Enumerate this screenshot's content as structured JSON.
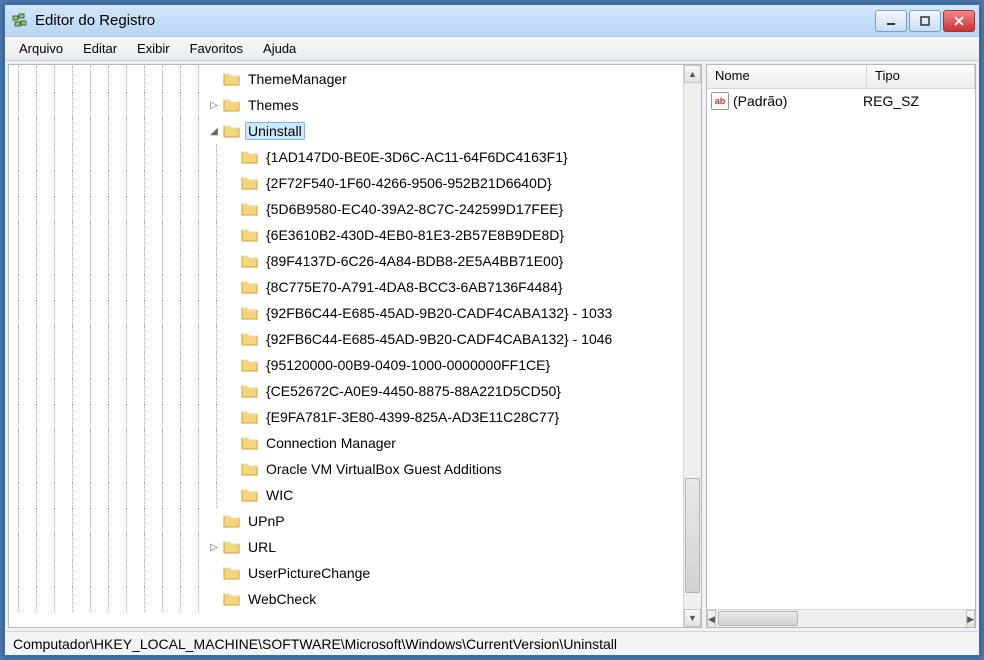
{
  "window": {
    "title": "Editor do Registro"
  },
  "menu": {
    "arquivo": "Arquivo",
    "editar": "Editar",
    "exibir": "Exibir",
    "favoritos": "Favoritos",
    "ajuda": "Ajuda"
  },
  "tree": {
    "items": [
      {
        "depth": 11,
        "expander": "",
        "label": "ThemeManager",
        "selected": false
      },
      {
        "depth": 11,
        "expander": "▷",
        "label": "Themes",
        "selected": false
      },
      {
        "depth": 11,
        "expander": "◢",
        "label": "Uninstall",
        "selected": true
      },
      {
        "depth": 12,
        "expander": "",
        "label": "{1AD147D0-BE0E-3D6C-AC11-64F6DC4163F1}",
        "selected": false
      },
      {
        "depth": 12,
        "expander": "",
        "label": "{2F72F540-1F60-4266-9506-952B21D6640D}",
        "selected": false
      },
      {
        "depth": 12,
        "expander": "",
        "label": "{5D6B9580-EC40-39A2-8C7C-242599D17FEE}",
        "selected": false
      },
      {
        "depth": 12,
        "expander": "",
        "label": "{6E3610B2-430D-4EB0-81E3-2B57E8B9DE8D}",
        "selected": false
      },
      {
        "depth": 12,
        "expander": "",
        "label": "{89F4137D-6C26-4A84-BDB8-2E5A4BB71E00}",
        "selected": false
      },
      {
        "depth": 12,
        "expander": "",
        "label": "{8C775E70-A791-4DA8-BCC3-6AB7136F4484}",
        "selected": false
      },
      {
        "depth": 12,
        "expander": "",
        "label": "{92FB6C44-E685-45AD-9B20-CADF4CABA132} - 1033",
        "selected": false
      },
      {
        "depth": 12,
        "expander": "",
        "label": "{92FB6C44-E685-45AD-9B20-CADF4CABA132} - 1046",
        "selected": false
      },
      {
        "depth": 12,
        "expander": "",
        "label": "{95120000-00B9-0409-1000-0000000FF1CE}",
        "selected": false
      },
      {
        "depth": 12,
        "expander": "",
        "label": "{CE52672C-A0E9-4450-8875-88A221D5CD50}",
        "selected": false
      },
      {
        "depth": 12,
        "expander": "",
        "label": "{E9FA781F-3E80-4399-825A-AD3E11C28C77}",
        "selected": false
      },
      {
        "depth": 12,
        "expander": "",
        "label": "Connection Manager",
        "selected": false
      },
      {
        "depth": 12,
        "expander": "",
        "label": "Oracle VM VirtualBox Guest Additions",
        "selected": false
      },
      {
        "depth": 12,
        "expander": "",
        "label": "WIC",
        "selected": false
      },
      {
        "depth": 11,
        "expander": "",
        "label": "UPnP",
        "selected": false
      },
      {
        "depth": 11,
        "expander": "▷",
        "label": "URL",
        "selected": false
      },
      {
        "depth": 11,
        "expander": "",
        "label": "UserPictureChange",
        "selected": false
      },
      {
        "depth": 11,
        "expander": "",
        "label": "WebCheck",
        "selected": false
      }
    ]
  },
  "values": {
    "columns": {
      "name": "Nome",
      "type": "Tipo"
    },
    "rows": [
      {
        "icon_text": "ab",
        "name": "(Padrão)",
        "type": "REG_SZ"
      }
    ]
  },
  "statusbar": {
    "path": "Computador\\HKEY_LOCAL_MACHINE\\SOFTWARE\\Microsoft\\Windows\\CurrentVersion\\Uninstall"
  }
}
